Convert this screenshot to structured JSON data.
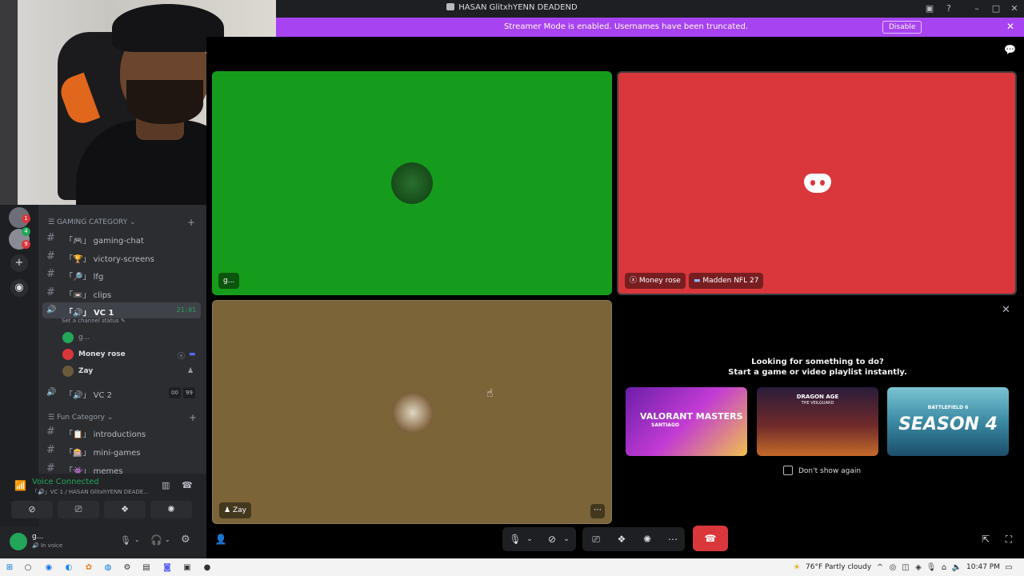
{
  "window": {
    "title": "HASAN GlitxhYENN DEADEND",
    "controls": [
      "inbox-icon",
      "help-icon",
      "minimize-icon",
      "maximize-icon",
      "close-icon"
    ]
  },
  "banner": {
    "text": "Streamer Mode is enabled. Usernames have been truncated.",
    "disable_label": "Disable",
    "color": "#a843f2"
  },
  "sidebar": {
    "categories": [
      {
        "label": "GAMING CATEGORY"
      },
      {
        "label": "Fun Category"
      }
    ],
    "channels": [
      {
        "prefix": "「🎮」",
        "name": "gaming-chat"
      },
      {
        "prefix": "「🏆」",
        "name": "victory-screens"
      },
      {
        "prefix": "「🔎」",
        "name": "lfg"
      },
      {
        "prefix": "「📼」",
        "name": "clips"
      },
      {
        "prefix": "「🔊」",
        "name": "VC 1",
        "timer": "21:01",
        "status": "Set a channel status"
      },
      {
        "prefix": "「🔊」",
        "name": "VC 2",
        "count_a": "00",
        "count_b": "99"
      },
      {
        "prefix": "「📋」",
        "name": "introductions"
      },
      {
        "prefix": "「🎰」",
        "name": "mini-games"
      },
      {
        "prefix": "「👾」",
        "name": "memes"
      }
    ],
    "voice_users": [
      {
        "name": "g...",
        "color": "#23a55a"
      },
      {
        "name": "Money rose",
        "color": "#da373c"
      },
      {
        "name": "Zay",
        "color": "#6b5a3a"
      }
    ],
    "guild_badges": [
      "1",
      "4",
      "9"
    ]
  },
  "voice_panel": {
    "status": "Voice Connected",
    "location": "「🔊」VC 1 / HASAN GlitxhYENN DEADE...",
    "status_color": "#23a55a"
  },
  "user_panel": {
    "name": "g...",
    "status": "In voice"
  },
  "tiles": {
    "g": {
      "label": "g...",
      "bg": "#169c1c"
    },
    "money": {
      "label": "Money rose",
      "game": "Madden NFL 27",
      "bg": "#da373c"
    },
    "zay": {
      "label": "Zay",
      "bg": "#7a6438"
    }
  },
  "activities": {
    "heading": "Looking for something to do?",
    "subheading": "Start a game or video playlist instantly.",
    "checkbox_label": "Don't show again",
    "cards": [
      {
        "title": "VALORANT MASTERS",
        "subtitle": "SANTIAGO"
      },
      {
        "title": "DRAGON AGE",
        "subtitle": "THE VEILGUARD"
      },
      {
        "title": "BATTLEFIELD 6",
        "subtitle": "SEASON 4"
      }
    ]
  },
  "taskbar": {
    "weather": "76°F  Partly cloudy",
    "time": "10:47 PM"
  }
}
